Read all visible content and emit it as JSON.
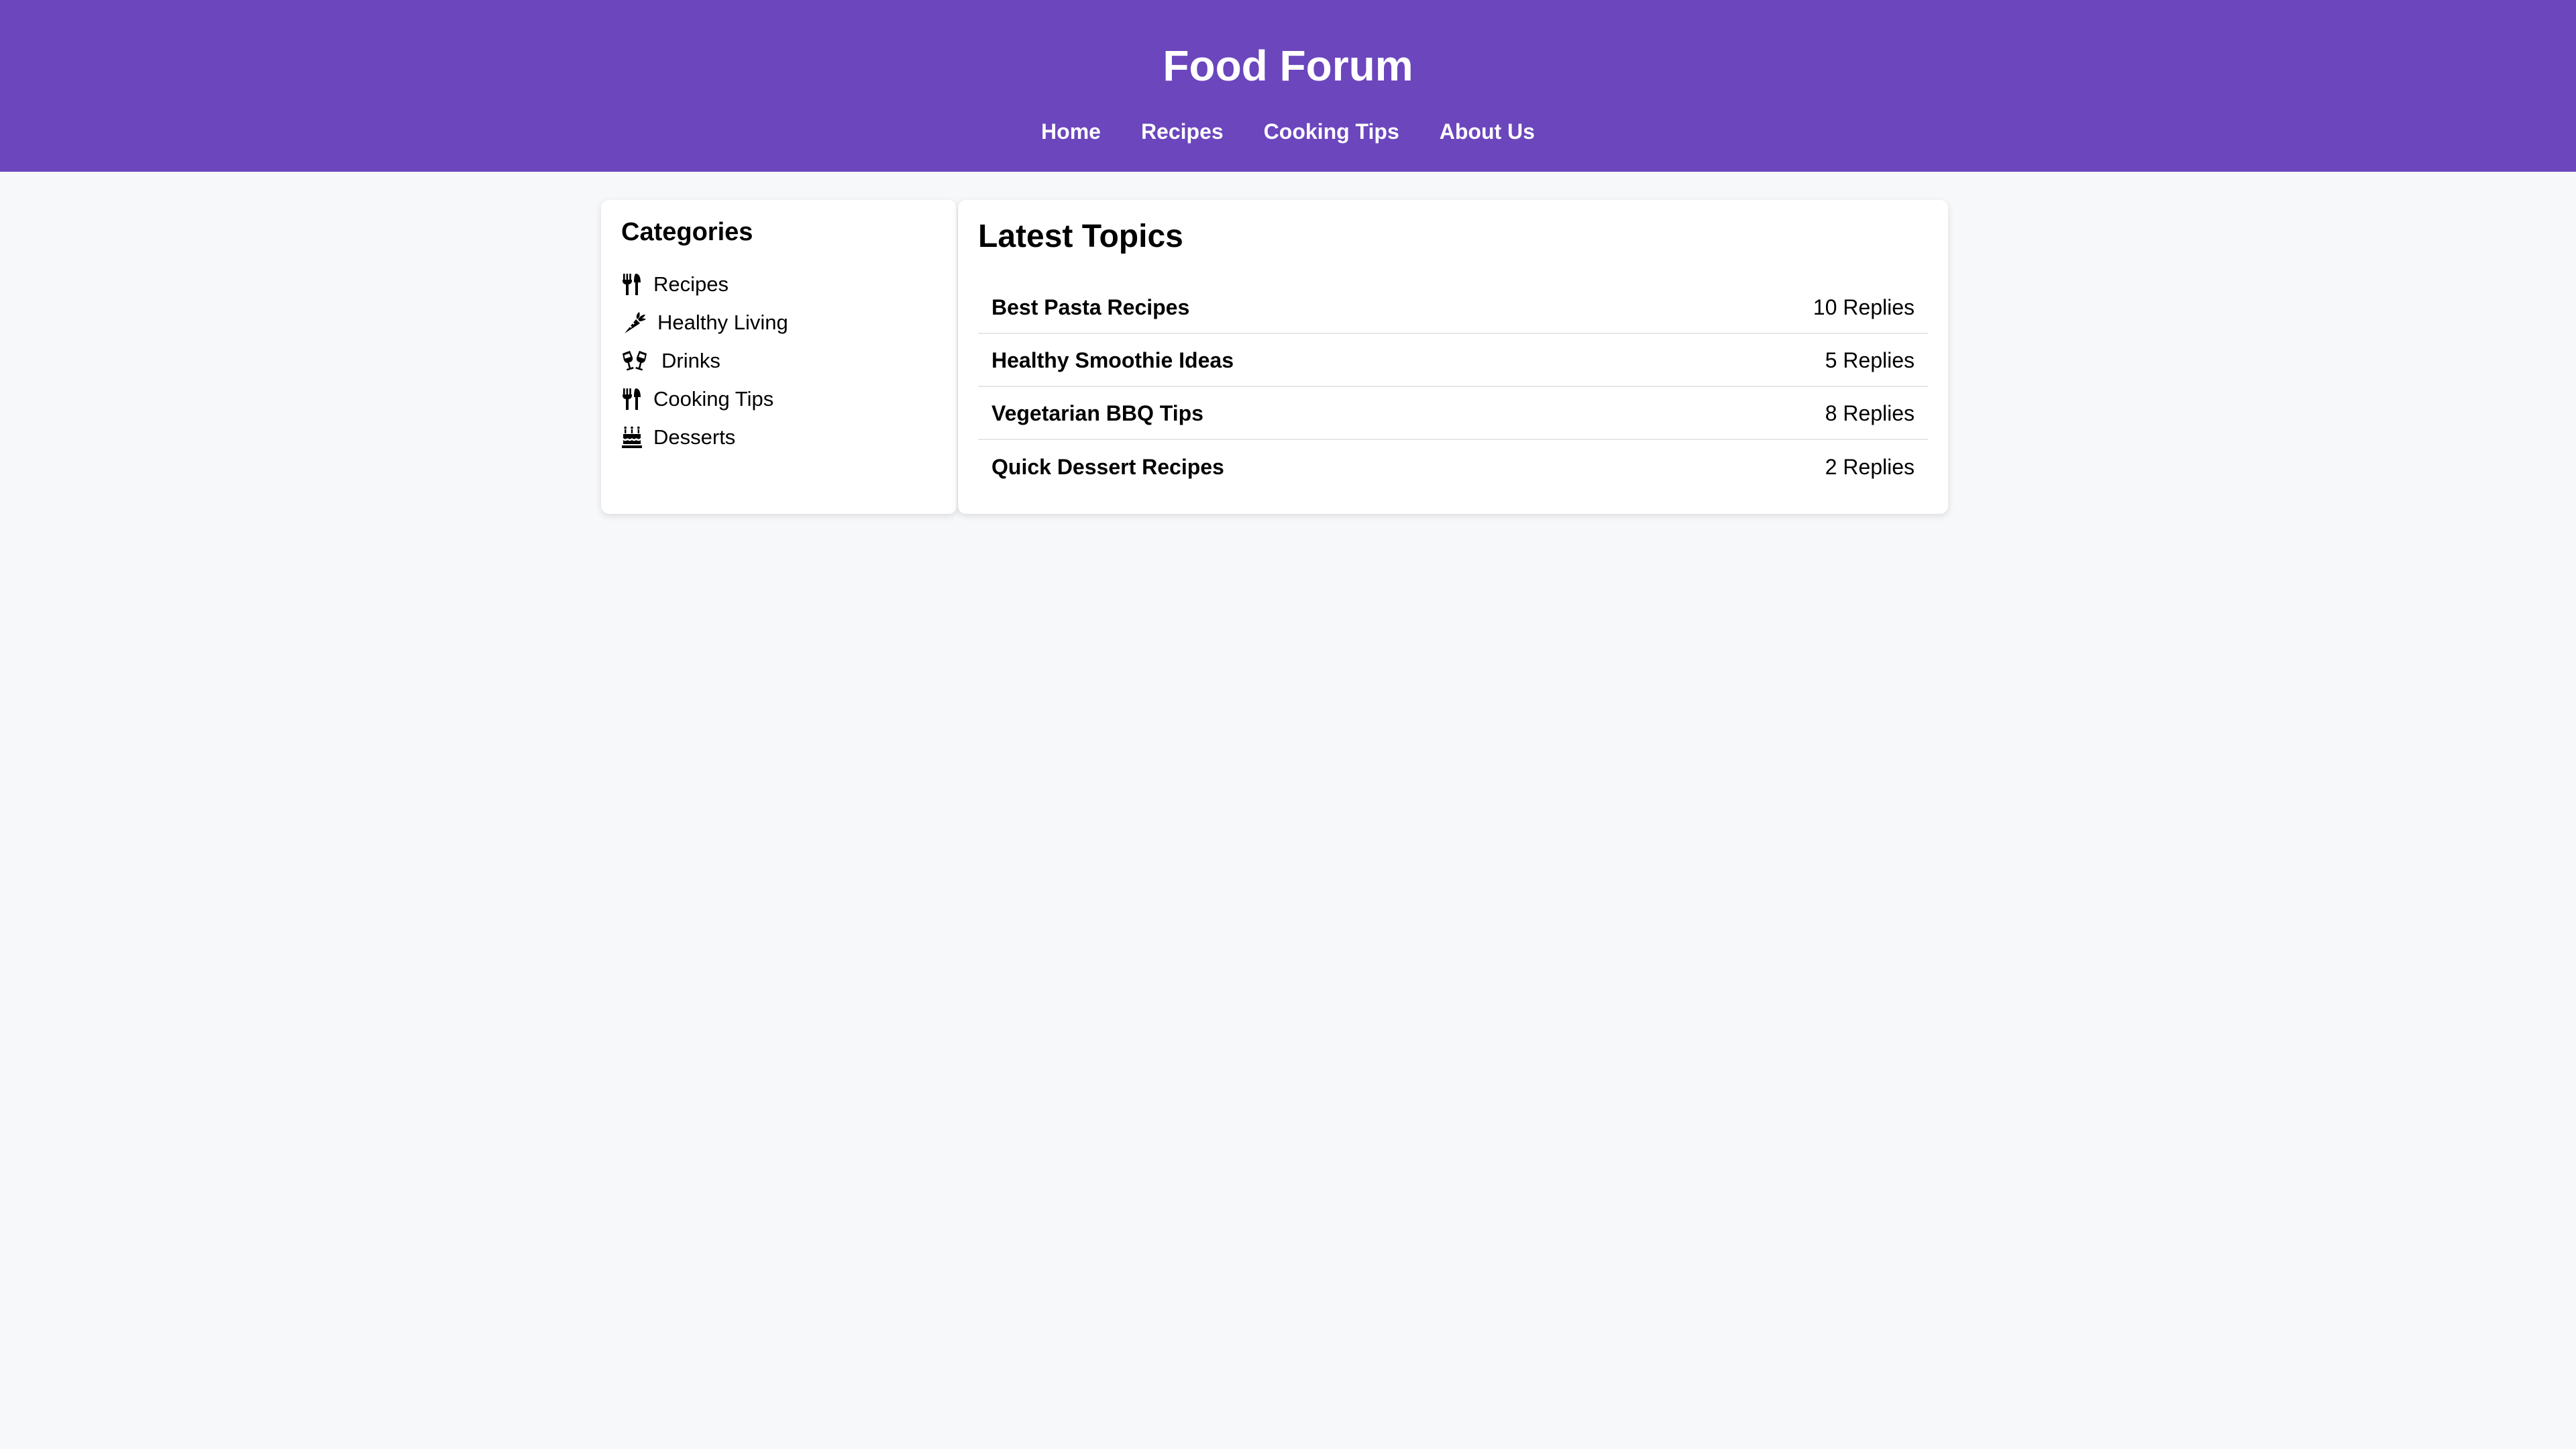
{
  "site": {
    "title": "Food Forum",
    "accent_color": "#6b46bd",
    "background_color": "#f7f8fa"
  },
  "nav": {
    "items": [
      {
        "label": "Home"
      },
      {
        "label": "Recipes"
      },
      {
        "label": "Cooking Tips"
      },
      {
        "label": "About Us"
      }
    ]
  },
  "sidebar": {
    "title": "Categories",
    "items": [
      {
        "label": "Recipes",
        "icon": "utensils-icon"
      },
      {
        "label": "Healthy Living",
        "icon": "carrot-icon"
      },
      {
        "label": "Drinks",
        "icon": "glasses-cheers-icon"
      },
      {
        "label": "Cooking Tips",
        "icon": "utensils-icon"
      },
      {
        "label": "Desserts",
        "icon": "birthday-cake-icon"
      }
    ]
  },
  "main": {
    "title": "Latest Topics",
    "topics": [
      {
        "name": "Best Pasta Recipes",
        "replies": "10 Replies"
      },
      {
        "name": "Healthy Smoothie Ideas",
        "replies": "5 Replies"
      },
      {
        "name": "Vegetarian BBQ Tips",
        "replies": "8 Replies"
      },
      {
        "name": "Quick Dessert Recipes",
        "replies": "2 Replies"
      }
    ]
  }
}
